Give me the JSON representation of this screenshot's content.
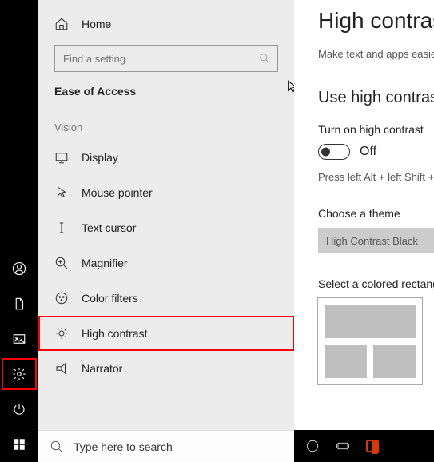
{
  "sidebar": {
    "home": "Home",
    "search_placeholder": "Find a setting",
    "header": "Ease of Access",
    "group": "Vision",
    "items": [
      {
        "label": "Display"
      },
      {
        "label": "Mouse pointer"
      },
      {
        "label": "Text cursor"
      },
      {
        "label": "Magnifier"
      },
      {
        "label": "Color filters"
      },
      {
        "label": "High contrast"
      },
      {
        "label": "Narrator"
      }
    ]
  },
  "main": {
    "title": "High contrast",
    "desc": "Make text and apps easier to see",
    "section_title": "Use high contrast",
    "toggle_label": "Turn on high contrast",
    "toggle_state": "Off",
    "hint": "Press left Alt + left Shift + Print Screen",
    "theme_label": "Choose a theme",
    "theme_value": "High Contrast Black",
    "rect_label": "Select a colored rectangle"
  },
  "taskbar": {
    "search_text": "Type here to search"
  }
}
